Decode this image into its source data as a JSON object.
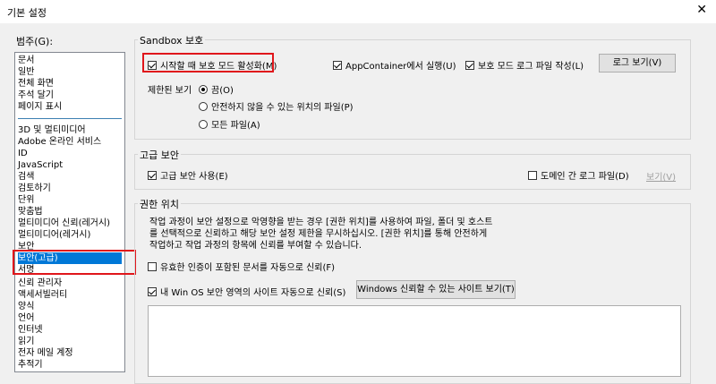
{
  "window": {
    "title": "기본 설정",
    "close_icon": "close-icon"
  },
  "categories": {
    "label": "범주(G):",
    "items_top": [
      "문서",
      "일반",
      "전체 화면",
      "주석 달기",
      "페이지 표시"
    ],
    "items_bottom": [
      "3D 및 멀티미디어",
      "Adobe 온라인 서비스",
      "ID",
      "JavaScript",
      "검색",
      "검토하기",
      "단위",
      "맞춤법",
      "멀티미디어 신뢰(레거시)",
      "멀티미디어(레거시)",
      "보안",
      "보안(고급)",
      "서명",
      "신뢰 관리자",
      "액세서빌러티",
      "양식",
      "언어",
      "인터넷",
      "읽기",
      "전자 메일 계정",
      "추적기"
    ],
    "selected": "보안(고급)"
  },
  "sandbox": {
    "title": "Sandbox 보호",
    "protected_mode": {
      "label": "시작할 때 보호 모드 활성화(M)",
      "checked": true
    },
    "appcontainer": {
      "label": "AppContainer에서 실행(U)",
      "checked": true
    },
    "protected_log": {
      "label": "보호 모드 로그 파일 작성(L)",
      "checked": true
    },
    "view_log_button": "로그 보기(V)",
    "restricted_view_label": "제한된 보기",
    "radio_options": [
      "끔(O)",
      "안전하지 않을 수 있는 위치의 파일(P)",
      "모든 파일(A)"
    ],
    "radio_selected": 0
  },
  "advanced": {
    "title": "고급 보안",
    "enable": {
      "label": "고급 보안 사용(E)",
      "checked": true
    },
    "crossdomain": {
      "label": "도메인 간 로그 파일(D)",
      "checked": false
    },
    "view_link": "보기(V)"
  },
  "privileged": {
    "title": "권한 위치",
    "description": [
      "작업 과정이 보안 설정으로 악영향을 받는 경우 [권한 위치]를 사용하여 파일, 폴더 및 호스트",
      "를 선택적으로 신뢰하고 해당 보안 설정 제한을 무시하십시오. [권한 위치]를 통해 안전하게",
      "작업하고 작업 과정의 항목에 신뢰를 부여할 수 있습니다."
    ],
    "trust_certified": {
      "label": "유효한 인증이 포함된 문서를 자동으로 신뢰(F)",
      "checked": false
    },
    "trust_winos": {
      "label": "내 Win OS 보안 영역의 사이트 자동으로 신뢰(S)",
      "checked": true
    },
    "view_sites_button": "Windows 신뢰할 수 있는 사이트 보기(T)"
  },
  "colors": {
    "highlight": "#e0161b",
    "selection": "#0078d7"
  }
}
